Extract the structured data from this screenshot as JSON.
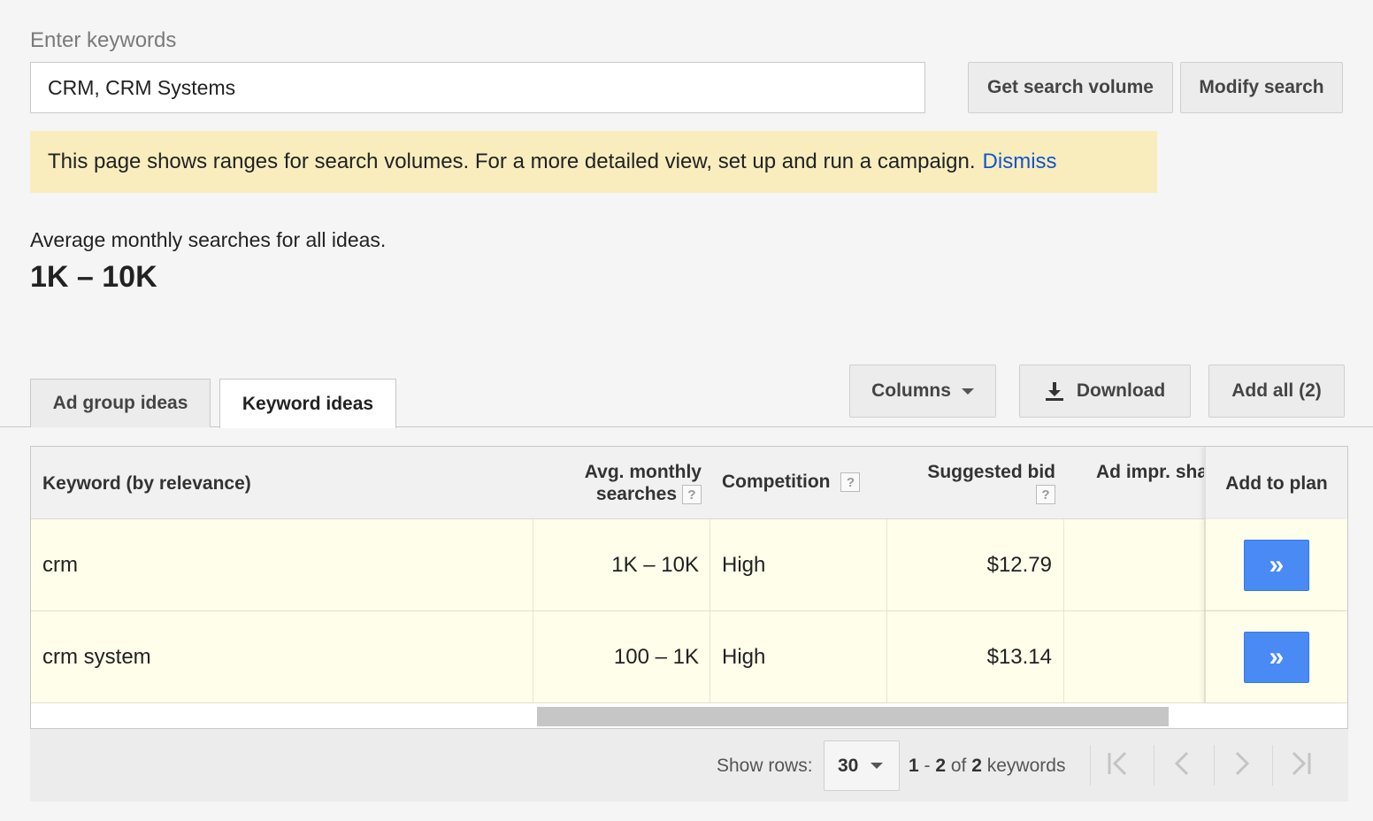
{
  "search": {
    "label": "Enter keywords",
    "value": "CRM, CRM Systems",
    "get_volume_label": "Get search volume",
    "modify_label": "Modify search"
  },
  "notice": {
    "text": "This page shows ranges for search volumes. For a more detailed view, set up and run a campaign.",
    "dismiss_label": "Dismiss"
  },
  "summary": {
    "label": "Average monthly searches for all ideas.",
    "value": "1K – 10K"
  },
  "tabs": [
    {
      "label": "Ad group ideas",
      "active": false
    },
    {
      "label": "Keyword ideas",
      "active": true
    }
  ],
  "toolbar": {
    "columns_label": "Columns",
    "download_label": "Download",
    "add_all_label": "Add all (2)"
  },
  "table": {
    "headers": {
      "keyword": "Keyword (by relevance)",
      "avg_line1": "Avg. monthly",
      "avg_line2": "searches",
      "competition": "Competition",
      "bid": "Suggested bid",
      "impr": "Ad impr. sha",
      "add": "Add to plan",
      "help": "?"
    },
    "rows": [
      {
        "keyword": "crm",
        "avg": "1K – 10K",
        "competition": "High",
        "bid": "$12.79",
        "add_glyph": "»"
      },
      {
        "keyword": "crm system",
        "avg": "100 – 1K",
        "competition": "High",
        "bid": "$13.14",
        "add_glyph": "»"
      }
    ]
  },
  "footer": {
    "show_rows_label": "Show rows:",
    "rows_value": "30",
    "range_start": "1",
    "range_sep": " - ",
    "range_end": "2",
    "range_of": " of ",
    "range_total": "2",
    "range_suffix": " keywords"
  },
  "icons": {
    "pager": [
      "first-page-icon",
      "prev-page-icon",
      "next-page-icon",
      "last-page-icon"
    ]
  },
  "colors": {
    "notice_bg": "#f9edbe",
    "link": "#1155cc",
    "row_bg": "#fefeea",
    "add_button": "#4a8af4"
  }
}
